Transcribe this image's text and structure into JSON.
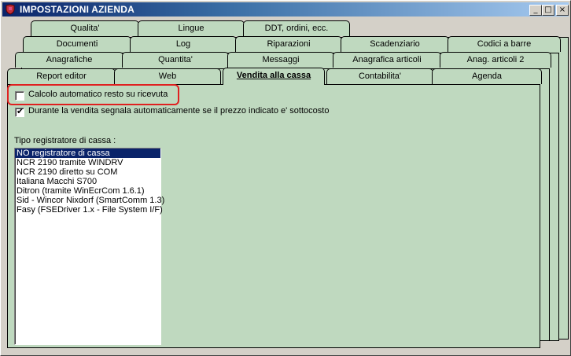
{
  "window": {
    "title": "IMPOSTAZIONI AZIENDA",
    "buttons": {
      "minimize": "_",
      "maximize": "□",
      "close": "×"
    }
  },
  "tabs": {
    "row1": [
      "Qualita'",
      "Lingue",
      "DDT, ordini, ecc."
    ],
    "row2": [
      "Documenti",
      "Log",
      "Riparazioni",
      "Scadenziario",
      "Codici a barre"
    ],
    "row3": [
      "Anagrafiche",
      "Quantita'",
      "Messaggi",
      "Anagrafica articoli",
      "Anag. articoli 2"
    ],
    "row4": [
      "Report editor",
      "Web",
      "Vendita alla cassa",
      "Contabilita'",
      "Agenda"
    ]
  },
  "active_tab": "Vendita alla cassa",
  "options": {
    "auto_change": {
      "label": "Calcolo automatico resto su ricevuta",
      "checked": false
    },
    "undercost_warning": {
      "label": "Durante la vendita segnala automaticamente se il prezzo indicato e' sottocosto",
      "checked": true
    }
  },
  "register": {
    "label": "Tipo registratore di cassa :",
    "items": [
      "NO registratore di cassa",
      "NCR 2190 tramite WINDRV",
      "NCR 2190 diretto su COM",
      "Italiana Macchi S700",
      "Ditron (tramite WinEcrCom 1.6.1)",
      "Sid - Wincor Nixdorf (SmartComm 1.3)",
      "Fasy (FSEDriver 1.x - File System I/F)"
    ],
    "selected_index": 0
  },
  "colors": {
    "panel": "#bfd9bf",
    "title_start": "#0a246a",
    "highlight": "#e02020"
  }
}
